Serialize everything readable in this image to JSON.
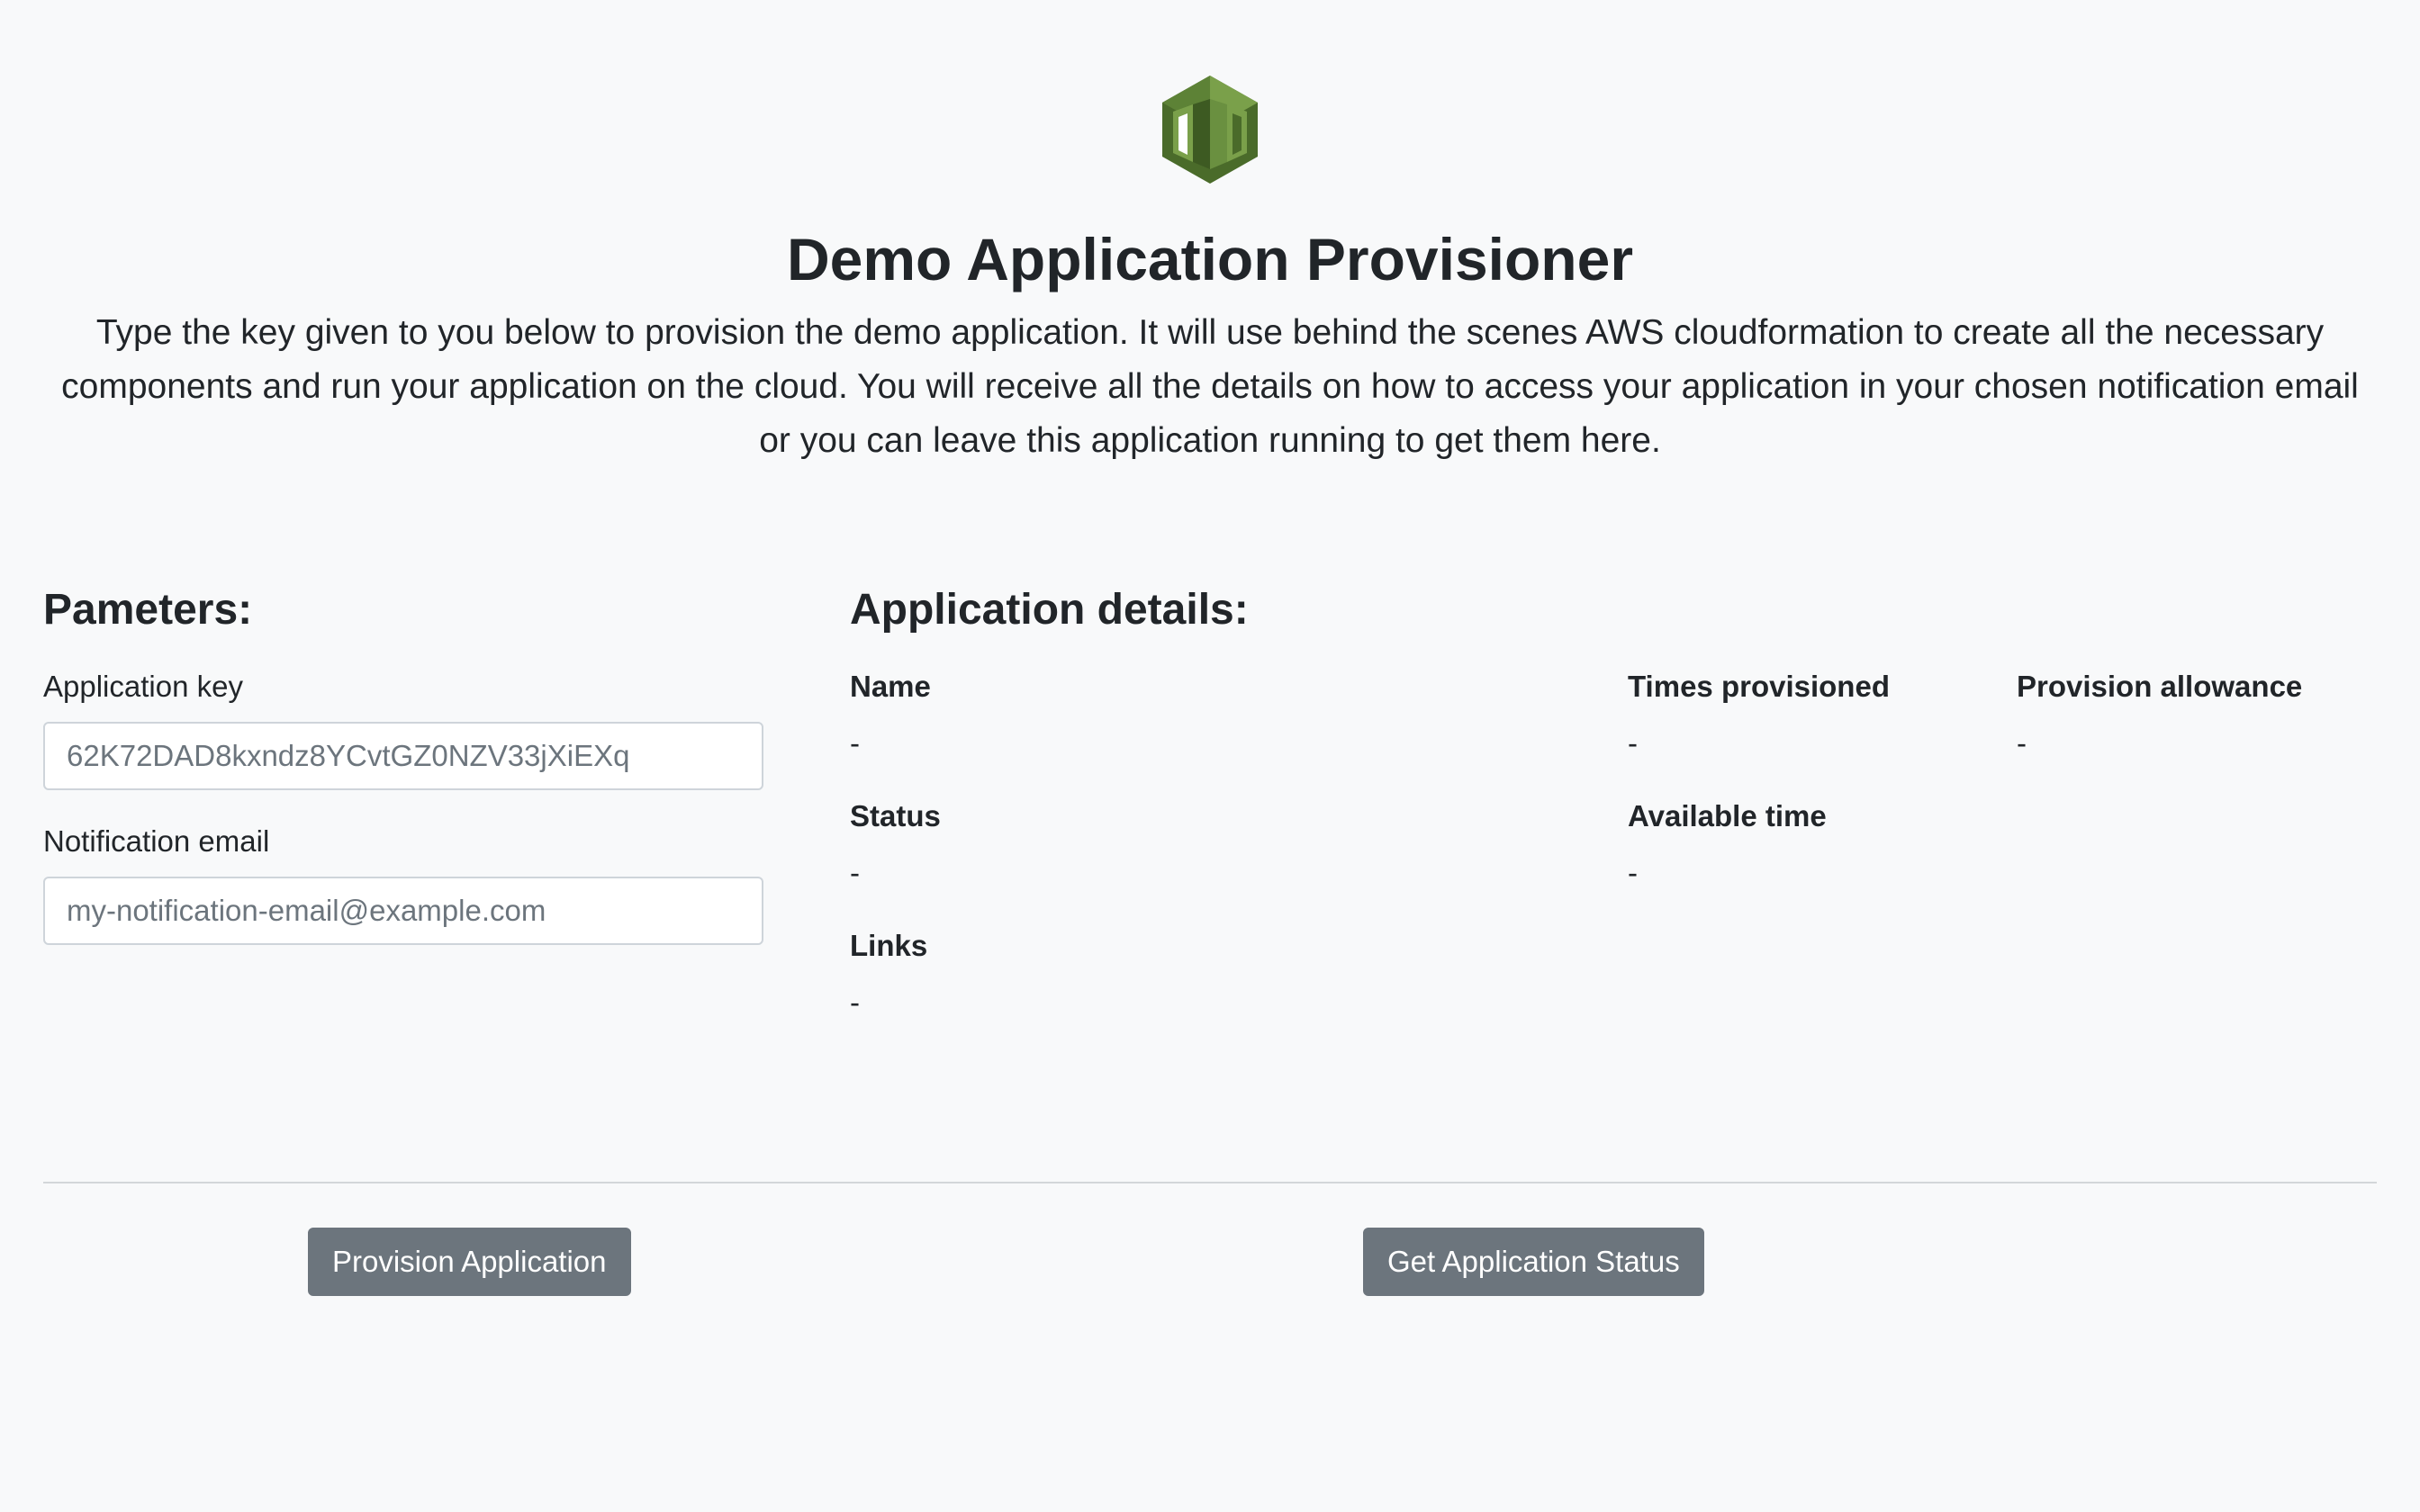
{
  "header": {
    "logo_icon": "aws-cloudformation-logo-icon",
    "title": "Demo Application Provisioner",
    "intro": "Type the key given to you below to provision the demo application. It will use behind the scenes AWS cloudformation to create all the necessary components and run your application on the cloud. You will receive all the details on how to access your application in your chosen notification email or you can leave this application running to get them here."
  },
  "parameters": {
    "heading": "Pameters:",
    "app_key_label": "Application key",
    "app_key_placeholder": "62K72DAD8kxndz8YCvtGZ0NZV33jXiEXq",
    "email_label": "Notification email",
    "email_placeholder": "my-notification-email@example.com"
  },
  "details": {
    "heading": "Application details:",
    "name_label": "Name",
    "name_value": "-",
    "times_provisioned_label": "Times provisioned",
    "times_provisioned_value": "-",
    "provision_allowance_label": "Provision allowance",
    "provision_allowance_value": "-",
    "status_label": "Status",
    "status_value": "-",
    "available_time_label": "Available time",
    "available_time_value": "-",
    "links_label": "Links",
    "links_value": "-"
  },
  "actions": {
    "provision_label": "Provision Application",
    "status_label": "Get Application Status"
  },
  "colors": {
    "background": "#f8f9fa",
    "button": "#6c757d",
    "logo_dark": "#4a6b2a",
    "logo_light": "#7aa04a"
  }
}
